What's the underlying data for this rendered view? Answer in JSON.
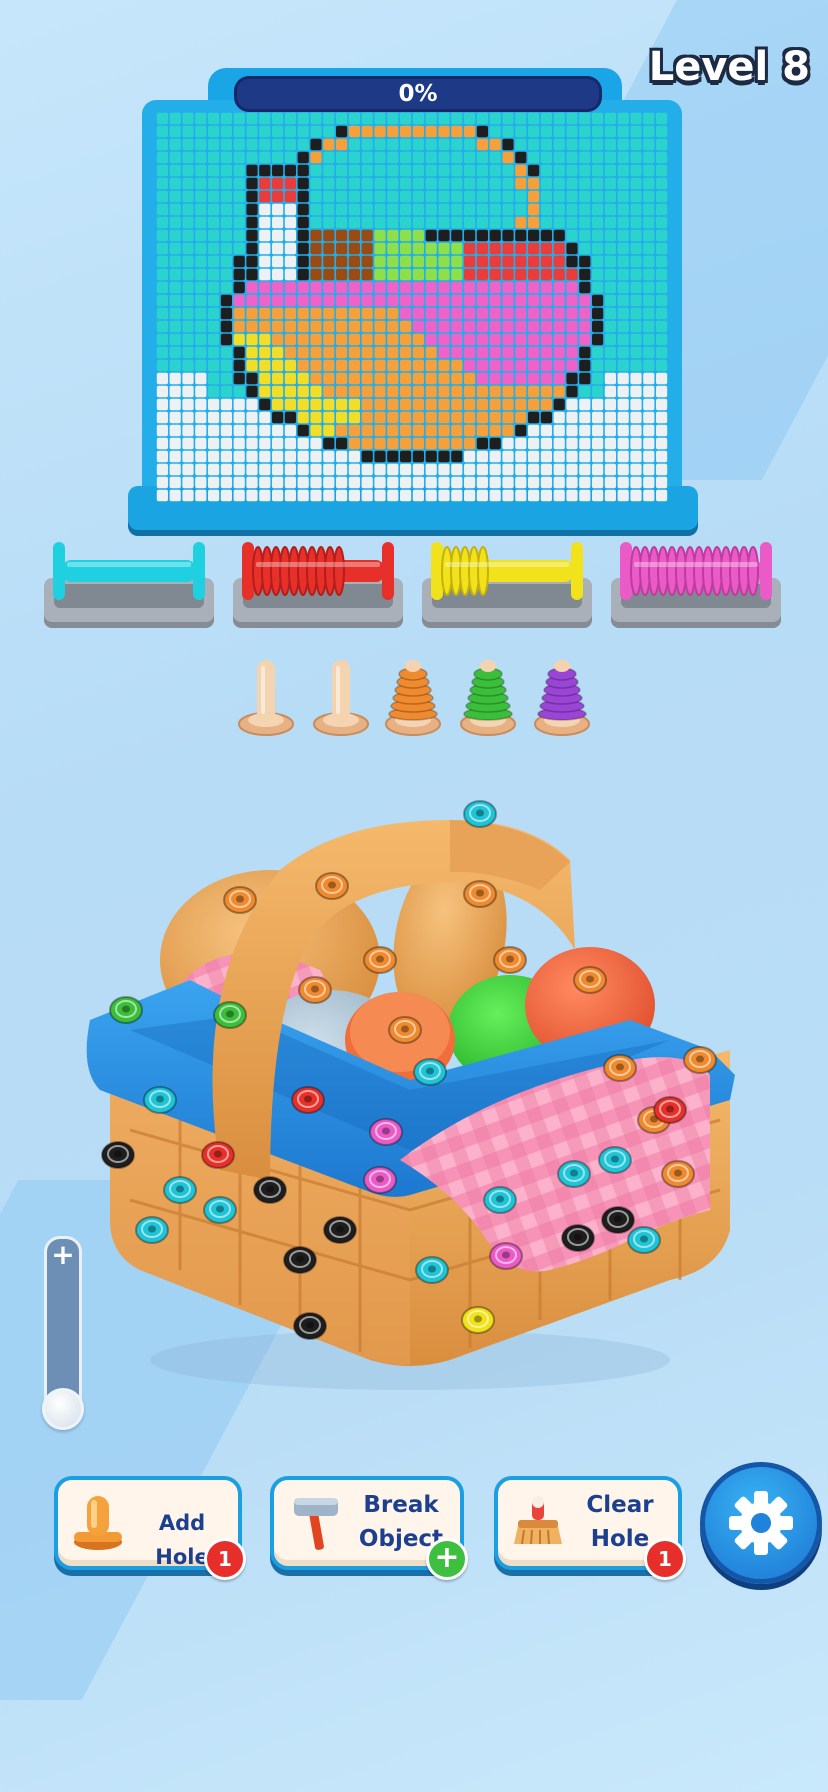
{
  "level": {
    "label": "Level 8"
  },
  "progress": {
    "text": "0%",
    "value": 0
  },
  "spools": [
    {
      "color_name": "cyan",
      "color": "#1fd0e0",
      "dark": "#11a6b8",
      "fill": 0.0
    },
    {
      "color_name": "red",
      "color": "#e8302a",
      "dark": "#b31d1a",
      "fill": 0.7
    },
    {
      "color_name": "yellow",
      "color": "#f2e21c",
      "dark": "#c4b20a",
      "fill": 0.35
    },
    {
      "color_name": "pink",
      "color": "#ea5bc7",
      "dark": "#c13aa0",
      "fill": 1.0
    }
  ],
  "pegs": [
    {
      "state": "empty",
      "color": null
    },
    {
      "state": "empty",
      "color": null
    },
    {
      "state": "threaded",
      "color": "#f08a2e"
    },
    {
      "state": "threaded",
      "color": "#3bbf3b"
    },
    {
      "state": "threaded",
      "color": "#9a45d6"
    }
  ],
  "puzzle_object": {
    "name": "picnic basket"
  },
  "zoom": {
    "plus_symbol": "+"
  },
  "buttons": {
    "add_hole": {
      "label": "Add Hole",
      "badge": "1",
      "icon": "peg-icon"
    },
    "break_object": {
      "label_line1": "Break",
      "label_line2": "Object",
      "badge": "+",
      "icon": "hammer-icon"
    },
    "clear_hole": {
      "label_line1": "Clear",
      "label_line2": "Hole",
      "badge": "1",
      "icon": "brush-icon"
    },
    "settings": {
      "icon": "gear-icon"
    }
  },
  "colors": {
    "accent": "#1aa6e6",
    "navy": "#1e3a86",
    "text_button": "#1c3f8e"
  }
}
